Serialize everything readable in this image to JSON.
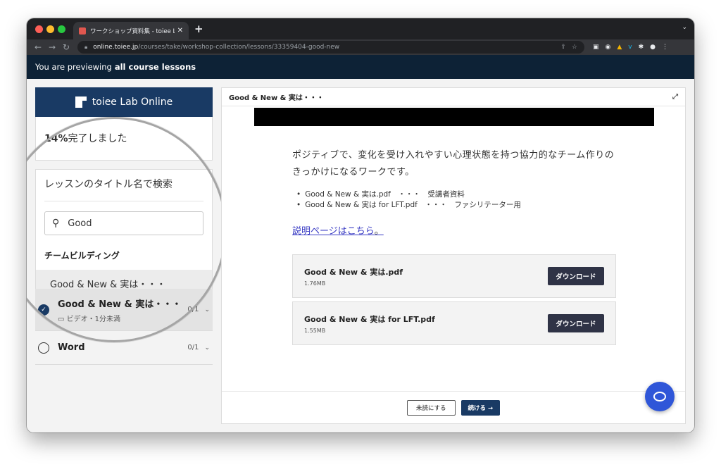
{
  "browser": {
    "tab_title": "ワークショップ資料集 - toiee Lab",
    "new_tab": "+",
    "tab_menu": "⌄",
    "url_host": "online.toiee.jp",
    "url_path": "/courses/take/workshop-collection/lessons/33359404-good-new"
  },
  "banner": {
    "prefix": "You are previewing",
    "emphasis": "all course lessons"
  },
  "sidebar": {
    "brand": "toiee Lab Online",
    "progress_percent": "14%",
    "progress_suffix": "完了しました",
    "search_label": "レッスンのタイトル名で検索",
    "search_value": "Good",
    "section_title": "チームビルディング",
    "search_result": "Good & New & 実は・・・",
    "lessons": [
      {
        "title": "Good & New & 実は・・・",
        "meta": "ビデオ・1分未満",
        "count": "0/1",
        "done": true
      },
      {
        "title": "Word",
        "meta": "",
        "count": "0/1",
        "done": false
      }
    ]
  },
  "player": {
    "header_title": "Good & New & 実は・・・",
    "description": "ポジティブで、変化を受け入れやすい心理状態を持つ協力的なチーム作りのきっかけになるワークです。",
    "files": [
      "Good & New & 実は.pdf　・・・　受講者資料",
      "Good & New & 実は for LFT.pdf　・・・　ファシリテーター用"
    ],
    "help_link": "説明ページはこちら",
    "help_tail": "。",
    "downloads": [
      {
        "name": "Good & New & 実は.pdf",
        "size": "1.76MB",
        "button": "ダウンロード"
      },
      {
        "name": "Good & New & 実は for LFT.pdf",
        "size": "1.55MB",
        "button": "ダウンロード"
      }
    ],
    "incomplete_label": "未読にする",
    "continue_label": "続ける →"
  },
  "colors": {
    "brand_navy": "#193a64",
    "banner_bg": "#0d2236",
    "link": "#3a3cc4",
    "chat": "#2f56d8"
  }
}
